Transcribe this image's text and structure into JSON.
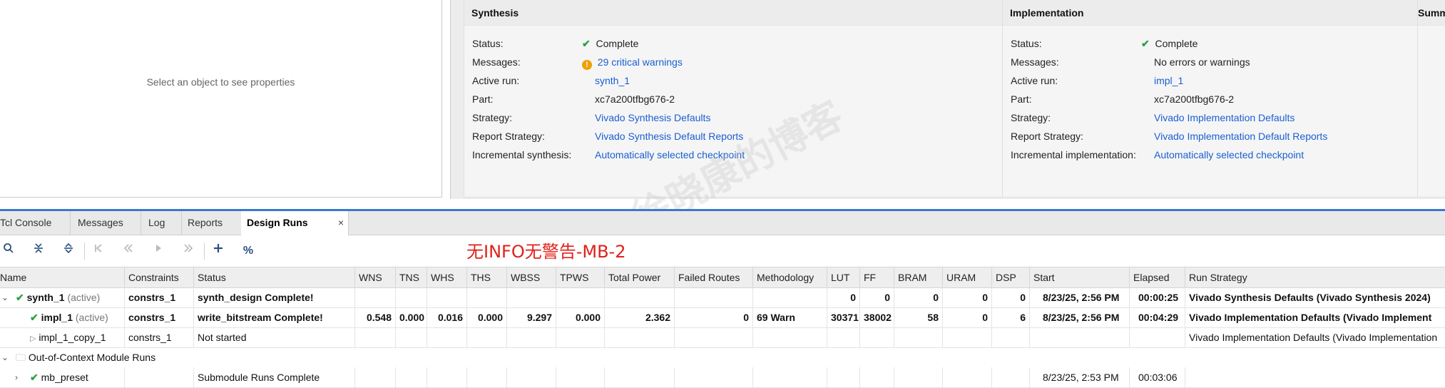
{
  "properties": {
    "hint": "Select an object to see properties"
  },
  "synthesis": {
    "title": "Synthesis",
    "rows": [
      {
        "label": "Status:",
        "value": "Complete"
      },
      {
        "label": "Messages:",
        "value": "29 critical warnings"
      },
      {
        "label": "Active run:",
        "value": "synth_1"
      },
      {
        "label": "Part:",
        "value": "xc7a200tfbg676-2"
      },
      {
        "label": "Strategy:",
        "value": "Vivado Synthesis Defaults"
      },
      {
        "label": "Report Strategy:",
        "value": "Vivado Synthesis Default Reports"
      },
      {
        "label": "Incremental synthesis:",
        "value": "Automatically selected checkpoint"
      }
    ]
  },
  "implementation": {
    "title": "Implementation",
    "rows": [
      {
        "label": "Status:",
        "value": "Complete"
      },
      {
        "label": "Messages:",
        "value": "No errors or warnings"
      },
      {
        "label": "Active run:",
        "value": "impl_1"
      },
      {
        "label": "Part:",
        "value": "xc7a200tfbg676-2"
      },
      {
        "label": "Strategy:",
        "value": "Vivado Implementation Defaults"
      },
      {
        "label": "Report Strategy:",
        "value": "Vivado Implementation Default Reports"
      },
      {
        "label": "Incremental implementation:",
        "value": "Automatically selected checkpoint"
      }
    ]
  },
  "summary": {
    "title": "Summ"
  },
  "tabs": [
    {
      "label": "Tcl Console"
    },
    {
      "label": "Messages"
    },
    {
      "label": "Log"
    },
    {
      "label": "Reports"
    },
    {
      "label": "Design Runs",
      "close": "×"
    }
  ],
  "annotation": "无INFO无警告-MB-2",
  "watermark": "徐晓康的博客",
  "colors": {
    "accent_blue": "#3a78d0",
    "link": "#1a5fd1",
    "ok_green": "#2ea043",
    "warning": "#f0a000",
    "annotation_red": "#e0201a"
  },
  "toolbar_icons": [
    "search-icon",
    "collapse-all-icon",
    "expand-all-icon",
    "first-icon",
    "previous-icon",
    "run-icon",
    "next-icon",
    "add-icon",
    "percent-icon"
  ],
  "table": {
    "columns": [
      "Name",
      "Constraints",
      "Status",
      "WNS",
      "TNS",
      "WHS",
      "THS",
      "WBSS",
      "TPWS",
      "Total Power",
      "Failed Routes",
      "Methodology",
      "LUT",
      "FF",
      "BRAM",
      "URAM",
      "DSP",
      "Start",
      "Elapsed",
      "Run Strategy"
    ],
    "rows": [
      {
        "name": "synth_1",
        "tag": "(active)",
        "constraints": "constrs_1",
        "status": "synth_design Complete!",
        "wns": "",
        "tns": "",
        "whs": "",
        "ths": "",
        "wbss": "",
        "tpws": "",
        "power": "",
        "failed": "",
        "methodology": "",
        "lut": "0",
        "ff": "0",
        "bram": "0",
        "uram": "0",
        "dsp": "0",
        "start": "8/23/25, 2:56 PM",
        "elapsed": "00:00:25",
        "strategy": "Vivado Synthesis Defaults (Vivado Synthesis 2024)"
      },
      {
        "name": "impl_1",
        "tag": "(active)",
        "constraints": "constrs_1",
        "status": "write_bitstream Complete!",
        "wns": "0.548",
        "tns": "0.000",
        "whs": "0.016",
        "ths": "0.000",
        "wbss": "9.297",
        "tpws": "0.000",
        "power": "2.362",
        "failed": "0",
        "methodology": "69 Warn",
        "lut": "30371",
        "ff": "38002",
        "bram": "58",
        "uram": "0",
        "dsp": "6",
        "start": "8/23/25, 2:56 PM",
        "elapsed": "00:04:29",
        "strategy": "Vivado Implementation Defaults (Vivado Implement"
      },
      {
        "name": "impl_1_copy_1",
        "constraints": "constrs_1",
        "status": "Not started",
        "strategy": "Vivado Implementation Defaults (Vivado Implementation"
      },
      {
        "name": "Out-of-Context Module Runs"
      },
      {
        "name": "mb_preset",
        "status": "Submodule Runs Complete",
        "start": "8/23/25, 2:53 PM",
        "elapsed": "00:03:06"
      }
    ]
  }
}
